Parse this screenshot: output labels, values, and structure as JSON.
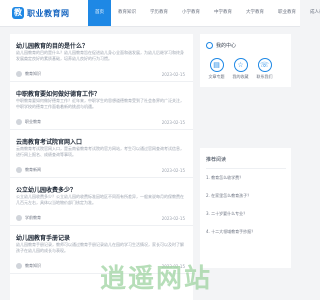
{
  "header": {
    "logo_text": "职业教育网",
    "nav": [
      "首页",
      "教育知识",
      "学历教育",
      "小学教育",
      "中学教育",
      "大学教育",
      "职业教育",
      "成人教育"
    ]
  },
  "articles": [
    {
      "title": "幼儿园教育的目的是什么？",
      "snippet": "幼儿园教育的目的是什么？幼儿园教育旨在促进幼儿身心全面和谐发展，为幼儿后继学习和终身发展奠定良好的素质基础，培养幼儿良好的行为习惯。",
      "author": "教育知识",
      "date": "2023-02-15"
    },
    {
      "title": "中职教育要如何做好德育工作？",
      "snippet": "中职教育要如何做好德育工作？近年来，中职学生的思想道德教育受到了社会各界的广泛关注，中职学校的德育工作面临着新的挑战与机遇。",
      "author": "职业教育",
      "date": "2023-02-15"
    },
    {
      "title": "云南教育考试院官网入口",
      "snippet": "云南教育考试院官网入口，是云南省教育考试院的官方网站，考生可以通过官网查询考试信息，进行网上报名、成绩查询等事项。",
      "author": "教育新闻",
      "date": "2023-02-15"
    },
    {
      "title": "公立幼儿园收费多少？",
      "snippet": "公立幼儿园收费多少？公立幼儿园的收费标准因地区不同而有所差异，一般来说每月的保教费在几百元左右，具体以当地物价部门核定为准。",
      "author": "学前教育",
      "date": "2023-02-15"
    },
    {
      "title": "幼儿园教育手册记录",
      "snippet": "幼儿园教育手册记录，教师可以通过教育手册记录幼儿在园的学习生活情况，家长可以及时了解孩子在幼儿园的成长与表现。",
      "author": "教育知识",
      "date": "2023-02-15"
    }
  ],
  "sidebar_user": {
    "title": "我的中心",
    "buttons": [
      {
        "label": "文章专题",
        "icon": "document-icon"
      },
      {
        "label": "我的收藏",
        "icon": "star-icon"
      },
      {
        "label": "联系我们",
        "icon": "phone-icon"
      }
    ]
  },
  "sidebar_list": {
    "title": "推荐阅读",
    "items": [
      "1. 教育怎么收学费？",
      "2. 在家里怎么教育孩子？",
      "3. 二十岁要什么专业？",
      "4. 十二大领域教育手抄报？"
    ]
  },
  "watermark": "逍遥网站"
}
